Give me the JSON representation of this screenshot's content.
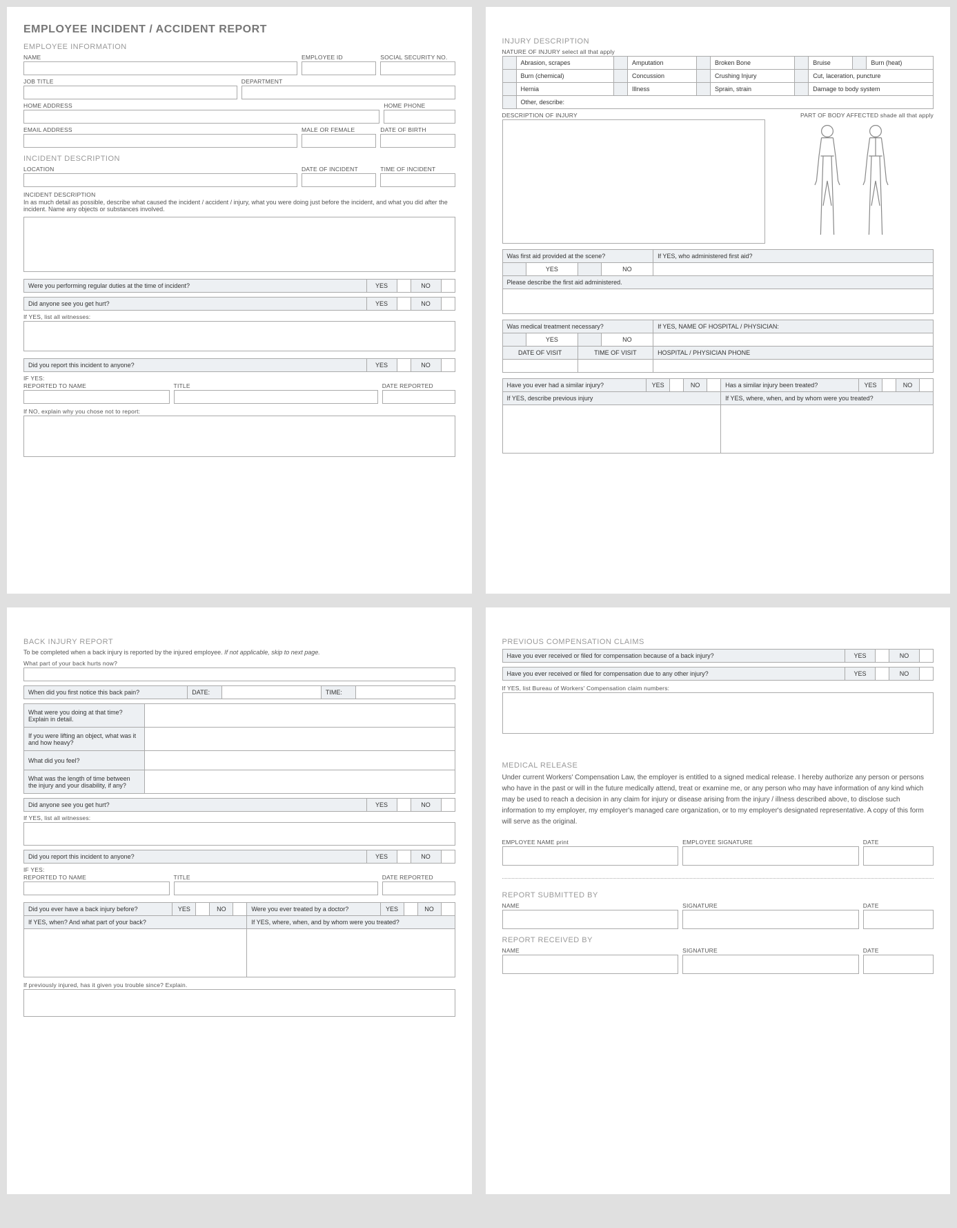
{
  "title": "EMPLOYEE INCIDENT / ACCIDENT REPORT",
  "emp_info": {
    "heading": "EMPLOYEE INFORMATION",
    "name": "NAME",
    "emp_id": "EMPLOYEE ID",
    "ssn": "SOCIAL SECURITY NO.",
    "job_title": "JOB TITLE",
    "department": "DEPARTMENT",
    "home_addr": "HOME ADDRESS",
    "home_phone": "HOME PHONE",
    "email": "EMAIL ADDRESS",
    "gender": "MALE OR FEMALE",
    "dob": "DATE OF BIRTH"
  },
  "incident": {
    "heading": "INCIDENT DESCRIPTION",
    "location": "LOCATION",
    "date": "DATE OF INCIDENT",
    "time": "TIME OF INCIDENT",
    "desc_label": "INCIDENT DESCRIPTION",
    "desc_hint": "In as much detail as possible, describe what caused the incident / accident / injury, what you were doing just before the incident, and what you did after the incident.  Name any objects or substances involved.",
    "q_regular": "Were you performing regular duties at the time of incident?",
    "q_seen": "Did anyone see you get hurt?",
    "witnesses": "If YES, list all witnesses:",
    "q_reported": "Did you report this incident to anyone?",
    "if_yes": "IF YES:",
    "reported_to": "REPORTED TO NAME",
    "title_l": "TITLE",
    "date_reported": "DATE REPORTED",
    "if_no": "If NO, explain why you chose not to report:"
  },
  "yes": "YES",
  "no": "NO",
  "injury": {
    "heading": "INJURY DESCRIPTION",
    "nature": "NATURE OF INJURY  select all that apply",
    "opts": {
      "abrasion": "Abrasion, scrapes",
      "amputation": "Amputation",
      "broken": "Broken Bone",
      "bruise": "Bruise",
      "burn_heat": "Burn (heat)",
      "burn_chem": "Burn (chemical)",
      "concussion": "Concussion",
      "crushing": "Crushing Injury",
      "cut": "Cut, laceration, puncture",
      "hernia": "Hernia",
      "illness": "Illness",
      "sprain": "Sprain, strain",
      "damage": "Damage to body system",
      "other": "Other, describe:"
    },
    "desc_of_injury": "DESCRIPTION OF INJURY",
    "body_part": "PART OF BODY AFFECTED  shade all that apply",
    "first_aid_q": "Was first aid provided at the scene?",
    "first_aid_who": "If YES, who administered first aid?",
    "first_aid_desc": "Please describe the first aid administered.",
    "med_treat_q": "Was medical treatment necessary?",
    "hosp_name": "If YES, NAME OF HOSPITAL / PHYSICIAN:",
    "date_visit": "DATE OF VISIT",
    "time_visit": "TIME OF VISIT",
    "hosp_phone": "HOSPITAL / PHYSICIAN PHONE",
    "similar_q": "Have you ever had a similar injury?",
    "similar_treated": "Has a similar injury been treated?",
    "prev_desc": "If YES, describe previous injury",
    "prev_where": "If YES, where, when, and by whom were you treated?"
  },
  "back": {
    "heading": "BACK INJURY REPORT",
    "sub": "To be completed when a back injury is reported by the injured employee.  If not applicable, skip to next page.",
    "sub_italic": "If not applicable, skip to next page.",
    "sub_pre": "To be completed when a back injury is reported by the injured employee.  ",
    "q_part": "What part of your back hurts now?",
    "q_when": "When did you first notice this back pain?",
    "date": "DATE:",
    "time": "TIME:",
    "q_doing": "What were you doing at that time?  Explain in detail.",
    "q_lift": "If you were lifting an object, what was it and how heavy?",
    "q_feel": "What did you feel?",
    "q_length": "What was the length of time between the injury and your disability, if any?",
    "q_seen": "Did anyone see you get hurt?",
    "witnesses": "If YES, list all witnesses:",
    "q_reported": "Did you report this incident to anyone?",
    "if_yes": "IF YES:",
    "reported_to": "REPORTED TO NAME",
    "title_l": "TITLE",
    "date_reported": "DATE REPORTED",
    "q_before": "Did you ever have a back injury before?",
    "q_doctor": "Were you ever treated by a doctor?",
    "q_when_part": "If YES, when? And what part of your back?",
    "q_where_who": "If YES, where, when, and by whom were you treated?",
    "q_trouble": "If previously injured, has it given you trouble since?  Explain."
  },
  "comp": {
    "heading": "PREVIOUS COMPENSATION CLAIMS",
    "q_back": "Have you ever received or filed for compensation because of a back injury?",
    "q_other": "Have you ever received or filed for compensation due to any other injury?",
    "list": "If YES, list Bureau of Workers' Compensation claim numbers:"
  },
  "release": {
    "heading": "MEDICAL RELEASE",
    "text": "Under current Workers' Compensation Law, the employer is entitled to a signed medical release.  I hereby authorize any person or persons who have in the past or will in the future medically attend, treat or examine me, or any person who may have information of any kind which may be used to reach a decision in any claim for injury or disease arising from the injury / illness described above, to disclose such information to my employer, my employer's managed care organization, or to my employer's designated representative.  A copy of this form will serve as the original.",
    "emp_name": "EMPLOYEE NAME  print",
    "emp_sig": "EMPLOYEE SIGNATURE",
    "date": "DATE"
  },
  "submit": {
    "heading": "REPORT SUBMITTED BY",
    "name": "NAME",
    "sig": "SIGNATURE",
    "date": "DATE"
  },
  "receive": {
    "heading": "REPORT RECEIVED BY",
    "name": "NAME",
    "sig": "SIGNATURE",
    "date": "DATE"
  }
}
